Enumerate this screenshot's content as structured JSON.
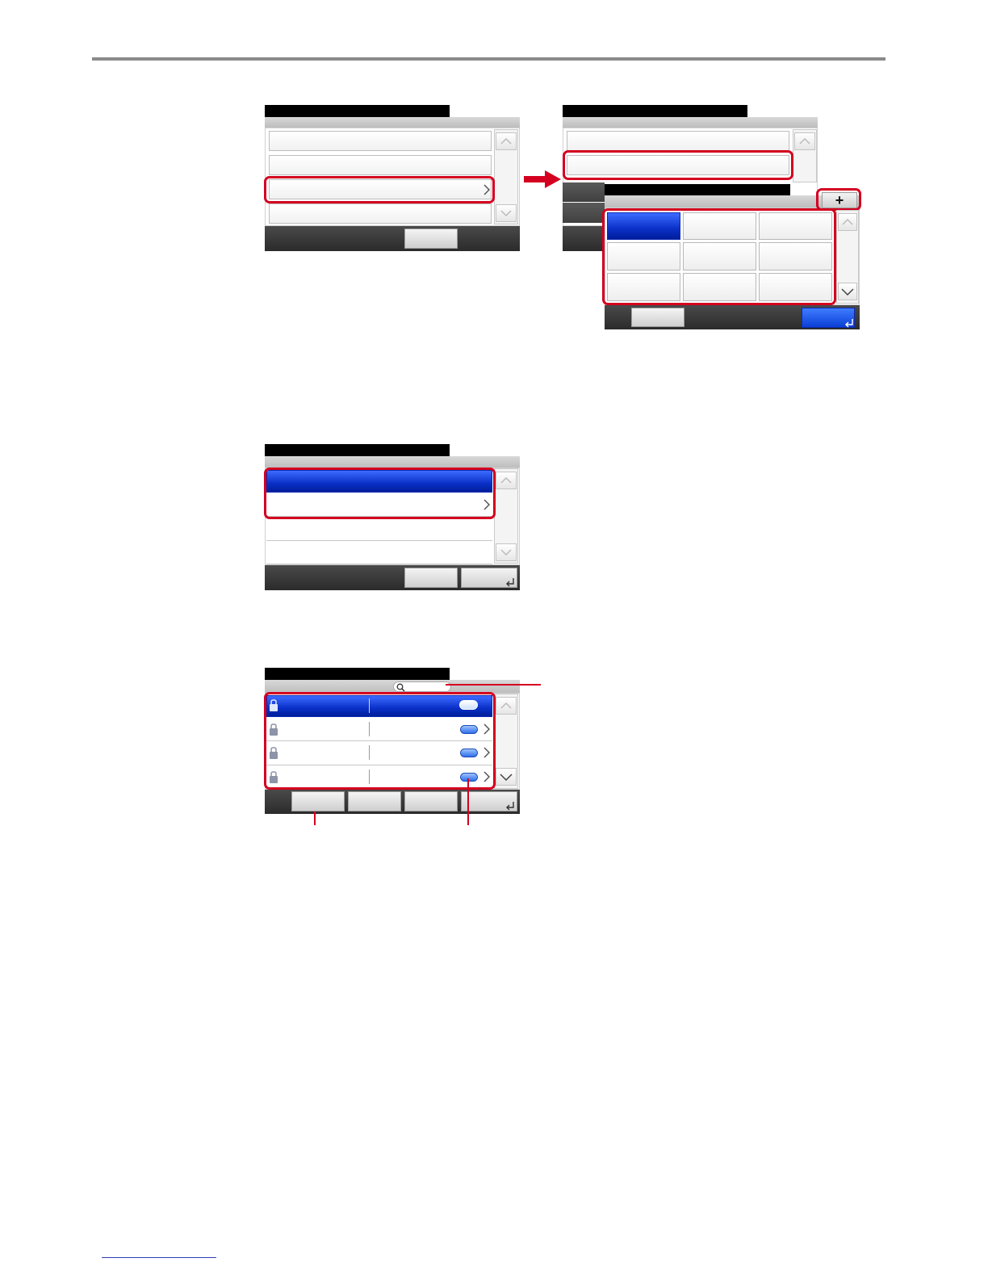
{
  "page": {
    "top_rule": "",
    "footer_link": ""
  },
  "figure1": {
    "left_screen": {
      "title": "",
      "rows": [
        "",
        "",
        "",
        ""
      ],
      "footer_button": ""
    },
    "right_screen": {
      "title": "",
      "rows": [
        "",
        ""
      ],
      "popup": {
        "title": "",
        "add_glyph": "+",
        "grid_cells": [
          "",
          "",
          "",
          "",
          "",
          "",
          "",
          "",
          ""
        ],
        "cancel_label": "",
        "ok_label": ""
      }
    },
    "arrow_icon": "arrow-right-icon"
  },
  "figure2": {
    "title": "",
    "rows": [
      "",
      "",
      "",
      ""
    ],
    "footer_buttons": [
      "",
      ""
    ]
  },
  "figure3": {
    "title": "",
    "search": {
      "placeholder": ""
    },
    "rows": [
      {
        "name": "",
        "detail": "",
        "selected": true
      },
      {
        "name": "",
        "detail": "",
        "selected": false
      },
      {
        "name": "",
        "detail": "",
        "selected": false
      },
      {
        "name": "",
        "detail": "",
        "selected": false
      }
    ],
    "footer_buttons": [
      "",
      "",
      "",
      ""
    ]
  },
  "colors": {
    "highlight": "#d4001f",
    "selection_blue": "#0a30c8",
    "title_bar": "#000000"
  }
}
